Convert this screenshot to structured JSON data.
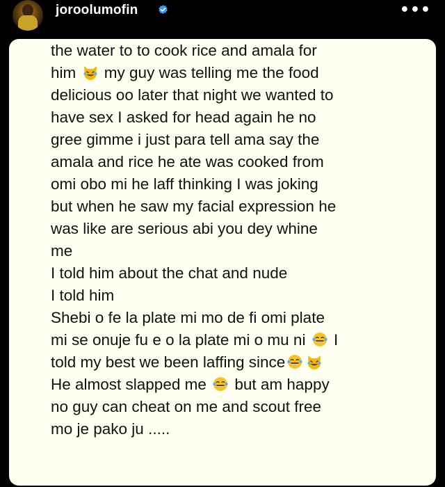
{
  "post": {
    "username": "joroolumofin",
    "more_icon": "more-horizontal-icon",
    "verified_icon": "verified-badge-icon"
  },
  "note": {
    "lines": [
      {
        "text": "the water to to cook rice and amala for"
      },
      {
        "text": "him",
        "after_emoji": "cat-tears-of-joy",
        "rest": " my guy was telling me the food"
      },
      {
        "text": "delicious oo later that night we wanted to"
      },
      {
        "text": "have sex I asked for head again he no"
      },
      {
        "text": "gree gimme i just para tell ama say the"
      },
      {
        "text": "amala and rice he ate was cooked from"
      },
      {
        "text": "omi obo mi he laff thinking I was joking"
      },
      {
        "text": "but when he saw my facial expression he"
      },
      {
        "text": "was like are serious abi you dey whine"
      },
      {
        "text": "me"
      },
      {
        "text": "I told him about the chat and nude"
      },
      {
        "text": "I told him"
      },
      {
        "text": "Shebi o fe la plate mi mo de fi omi plate"
      },
      {
        "text": "mi se onuje fu e o la plate mi o mu ni",
        "after_emoji": "face-tears-of-joy",
        "rest": " I"
      },
      {
        "text": "told my best we been laffing since",
        "after_emoji": "face-tears-of-joy",
        "after_emoji2": "cat-tears-of-joy",
        "rest": ""
      },
      {
        "text": "He almost slapped me ",
        "after_emoji": "face-tears-of-joy",
        "rest": " but am happy"
      },
      {
        "text": "no guy can cheat on me and scout free"
      },
      {
        "text": "mo je pako ju ....."
      }
    ]
  },
  "colors": {
    "background": "#000000",
    "note_background": "#fffff1",
    "text": "#111111",
    "verified_blue": "#3897f0"
  }
}
